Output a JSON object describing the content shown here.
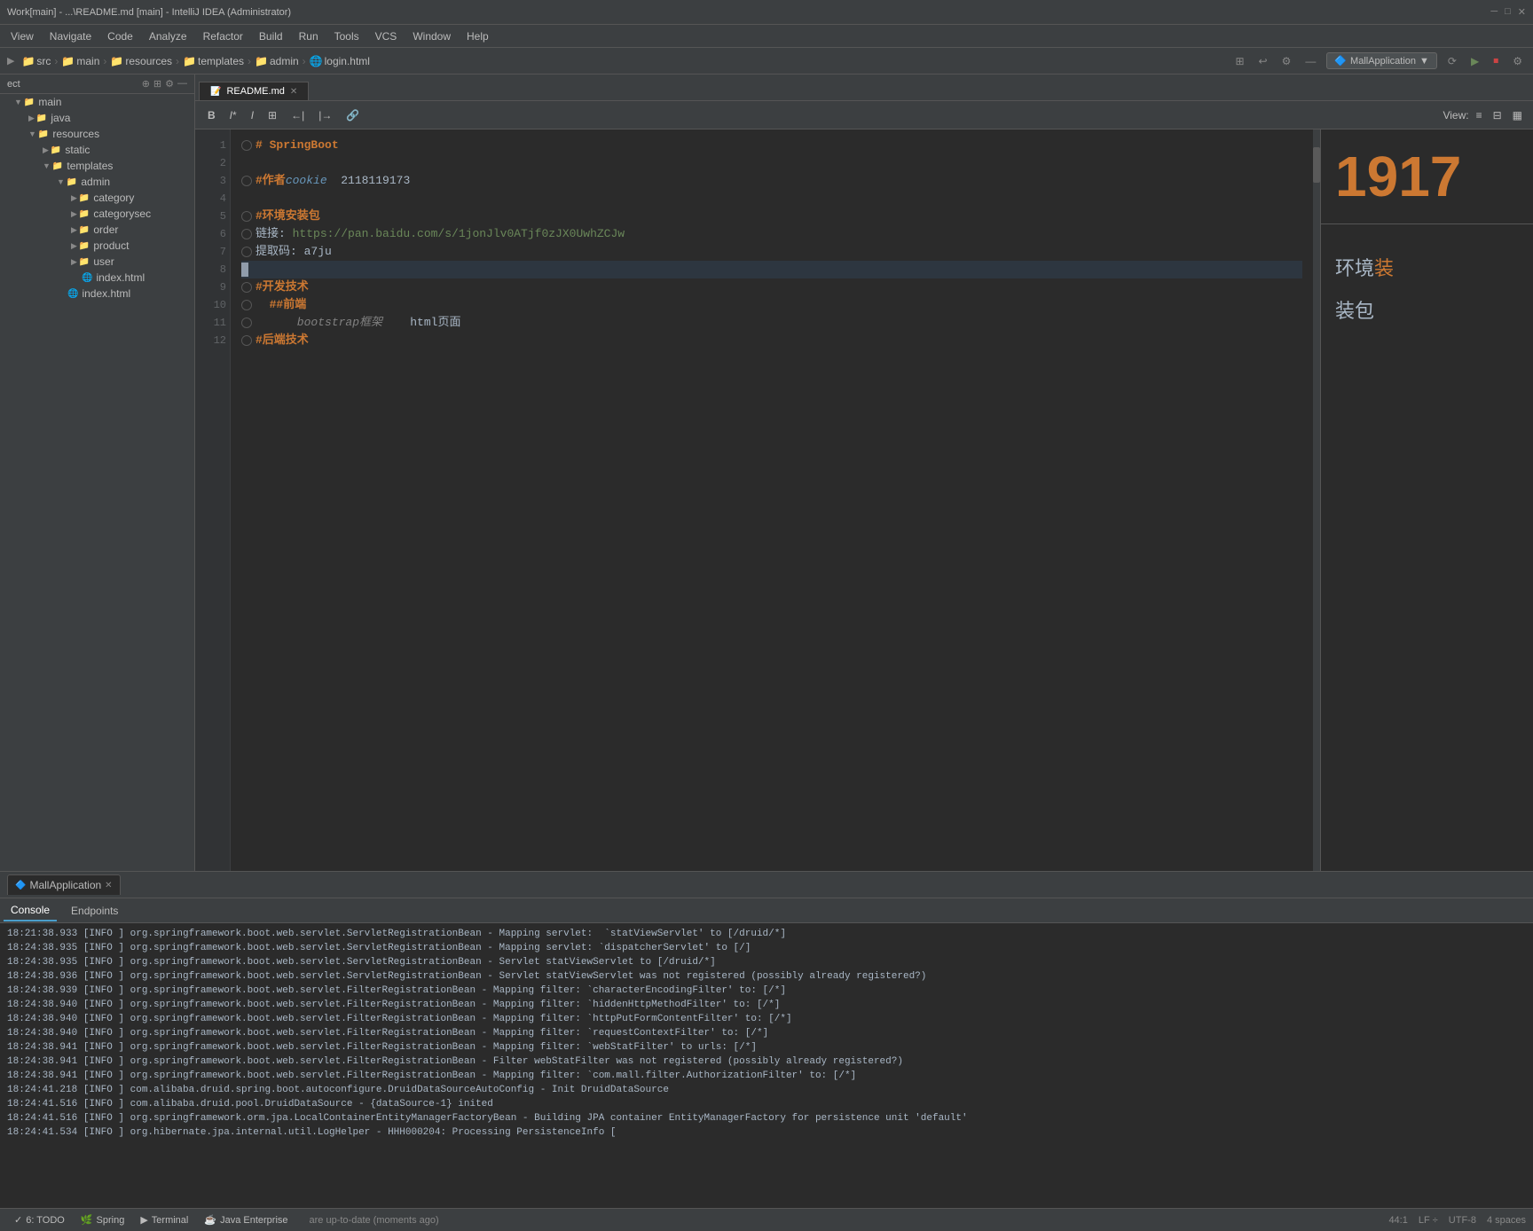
{
  "titleBar": {
    "text": "Work[main] - ...\\README.md [main] - IntelliJ IDEA (Administrator)"
  },
  "menuBar": {
    "items": [
      "View",
      "Navigate",
      "Code",
      "Analyze",
      "Refactor",
      "Build",
      "Run",
      "Tools",
      "VCS",
      "Window",
      "Help"
    ]
  },
  "breadcrumb": {
    "items": [
      "src",
      "main",
      "resources",
      "templates",
      "admin",
      "login.html"
    ],
    "appName": "MallApplication"
  },
  "tab": {
    "label": "README.md",
    "icon": "📄"
  },
  "mdToolbar": {
    "buttons": [
      "B",
      "I*",
      "I",
      "⊞",
      "←|",
      "|→",
      "🔗"
    ],
    "viewLabel": "View:"
  },
  "editor": {
    "lines": [
      {
        "num": 1,
        "content": "# SpringBoot",
        "type": "heading"
      },
      {
        "num": 2,
        "content": "",
        "type": "empty"
      },
      {
        "num": 3,
        "content": "#作者cookie  2118119173",
        "type": "heading-author"
      },
      {
        "num": 4,
        "content": "",
        "type": "empty"
      },
      {
        "num": 5,
        "content": "#环境安装包",
        "type": "heading"
      },
      {
        "num": 6,
        "content": "链接: https://pan.baidu.com/s/1jonJlv0ATjf0zJX0UwhZCJw",
        "type": "link"
      },
      {
        "num": 7,
        "content": "提取码: a7ju",
        "type": "text"
      },
      {
        "num": 8,
        "content": "",
        "type": "empty",
        "cursor": true
      },
      {
        "num": 9,
        "content": "#开发技术",
        "type": "heading"
      },
      {
        "num": 10,
        "content": "  ##前端",
        "type": "subheading"
      },
      {
        "num": 11,
        "content": "      bootstrap框架    html页面",
        "type": "text"
      },
      {
        "num": 12,
        "content": "#后端技术",
        "type": "heading"
      }
    ]
  },
  "rightPanel": {
    "number": "1917",
    "text1": "环境装",
    "text2": "装包"
  },
  "sidebar": {
    "projectLabel": "ect",
    "tree": [
      {
        "label": "main",
        "type": "folder",
        "level": 0,
        "expanded": true,
        "arrow": "down"
      },
      {
        "label": "java",
        "type": "folder",
        "level": 1,
        "expanded": false,
        "arrow": "right"
      },
      {
        "label": "resources",
        "type": "folder",
        "level": 1,
        "expanded": true,
        "arrow": "down"
      },
      {
        "label": "static",
        "type": "folder",
        "level": 2,
        "expanded": false,
        "arrow": "right"
      },
      {
        "label": "templates",
        "type": "folder",
        "level": 2,
        "expanded": true,
        "arrow": "down"
      },
      {
        "label": "admin",
        "type": "folder",
        "level": 3,
        "expanded": true,
        "arrow": "down"
      },
      {
        "label": "category",
        "type": "folder",
        "level": 4,
        "expanded": false,
        "arrow": "right"
      },
      {
        "label": "categorysec",
        "type": "folder",
        "level": 4,
        "expanded": false,
        "arrow": "right"
      },
      {
        "label": "order",
        "type": "folder",
        "level": 4,
        "expanded": false,
        "arrow": "right"
      },
      {
        "label": "product",
        "type": "folder",
        "level": 4,
        "expanded": false,
        "arrow": "right"
      },
      {
        "label": "user",
        "type": "folder",
        "level": 4,
        "expanded": false,
        "arrow": "right"
      },
      {
        "label": "index.html",
        "type": "html",
        "level": 4
      },
      {
        "label": "index.html",
        "type": "html",
        "level": 3
      }
    ]
  },
  "consoleTabs": {
    "appTab": "MallApplication",
    "innerTabs": [
      "Console",
      "Endpoints"
    ]
  },
  "consoleOutput": [
    "18:21:38.933 [INFO ] org.springframework.boot.web.servlet.ServletRegistrationBean - Mapping servlet: `statViewServlet' to [/druid/*]",
    "18:24:38.935 [INFO ] org.springframework.boot.web.servlet.ServletRegistrationBean - Mapping servlet: `dispatcherServlet' to [/]",
    "18:24:38.935 [INFO ] org.springframework.boot.web.servlet.ServletRegistrationBean - Servlet statViewServlet to [/druid/*]",
    "18:24:38.936 [INFO ] org.springframework.boot.web.servlet.ServletRegistrationBean - Servlet statViewServlet was not registered (possibly already registered?)",
    "18:24:38.939 [INFO ] org.springframework.boot.web.servlet.FilterRegistrationBean - Mapping filter: `characterEncodingFilter' to: [/*]",
    "18:24:38.940 [INFO ] org.springframework.boot.web.servlet.FilterRegistrationBean - Mapping filter: `hiddenHttpMethodFilter' to: [/*]",
    "18:24:38.940 [INFO ] org.springframework.boot.web.servlet.FilterRegistrationBean - Mapping filter: `httpPutFormContentFilter' to: [/*]",
    "18:24:38.940 [INFO ] org.springframework.boot.web.servlet.FilterRegistrationBean - Mapping filter: `requestContextFilter' to: [/*]",
    "18:24:38.941 [INFO ] org.springframework.boot.web.servlet.FilterRegistrationBean - Mapping filter: `webStatFilter' to urls: [/*]",
    "18:24:38.941 [INFO ] org.springframework.boot.web.servlet.FilterRegistrationBean - Filter webStatFilter was not registered (possibly already registered?)",
    "18:24:38.941 [INFO ] org.springframework.boot.web.servlet.FilterRegistrationBean - Mapping filter: `com.mall.filter.AuthorizationFilter' to: [/*]",
    "18:24:41.218 [INFO ] com.alibaba.druid.spring.boot.autoconfigure.DruidDataSourceAutoConfig - Init DruidDataSource",
    "18:24:41.516 [INFO ] com.alibaba.druid.pool.DruidDataSource - {dataSource-1} inited",
    "18:24:41.516 [INFO ] org.springframework.orm.jpa.LocalContainerEntityManagerFactoryBean - Building JPA container EntityManagerFactory for persistence unit 'default'",
    "18:24:41.534 [INFO ] org.hibernate.jpa.internal.util.LogHelper - HHH000204: Processing PersistenceInfo ["
  ],
  "statusBar": {
    "message": "are up-to-date (moments ago)",
    "bottomTabs": [
      "6: TODO",
      "Spring",
      "Terminal",
      "Java Enterprise"
    ],
    "rightInfo": [
      "44:1",
      "LF ÷",
      "UTF-8",
      "4 spaces"
    ]
  }
}
